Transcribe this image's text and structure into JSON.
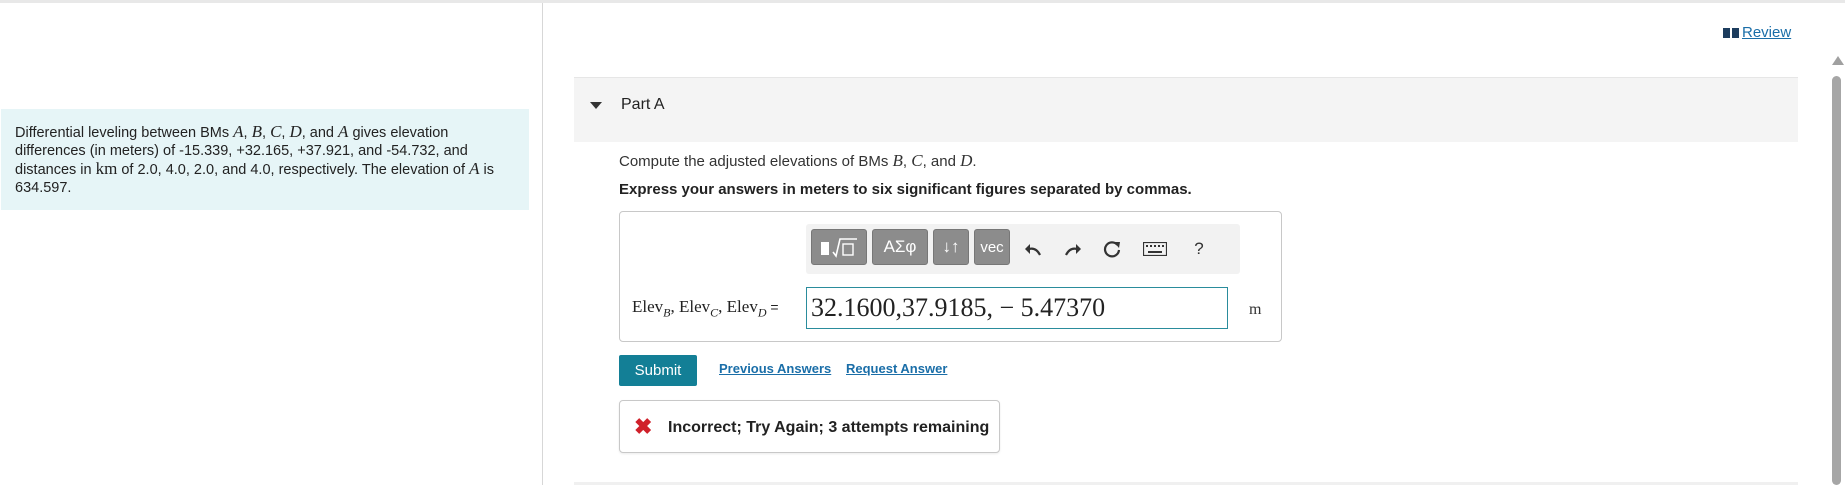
{
  "problem": {
    "t1": "Differential leveling between BMs ",
    "bmA": "A",
    "c1": ", ",
    "bmB": "B",
    "c2": ", ",
    "bmC": "C",
    "c3": ", ",
    "bmD": "D",
    "t2": ", and ",
    "bmA2": "A",
    "t3": " gives elevation differences (in meters) of -15.339, +32.165, +37.921, and -54.732, and distances in ",
    "km": "km",
    "t4": " of 2.0, 4.0, 2.0, and 4.0, respectively. The elevation of ",
    "bmA3": "A",
    "t5": " is 634.597."
  },
  "review": {
    "label": "Review",
    "icon": "book-icon"
  },
  "part": {
    "title": "Part A"
  },
  "question": {
    "t1": "Compute the adjusted elevations of BMs ",
    "b": "B",
    "c": ", ",
    "cc": "C",
    "and": ", and ",
    "d": "D",
    "end": "."
  },
  "instruction": "Express your answers in meters to six significant figures separated by commas.",
  "toolbar": {
    "greek": "ΑΣφ",
    "arrows": "↓↑",
    "vec": "vec",
    "help": "?"
  },
  "answer": {
    "elev": "Elev",
    "sub_b": "B",
    "sub_c": "C",
    "sub_d": "D",
    "sep": ", ",
    "eq": " =",
    "value": "32.1600,37.9185, − 5.47370",
    "unit": "m"
  },
  "buttons": {
    "submit": "Submit",
    "previous": "Previous Answers",
    "request": "Request Answer"
  },
  "feedback": {
    "icon": "✖",
    "text": "Incorrect; Try Again; 3 attempts remaining"
  },
  "colors": {
    "accent": "#137f96",
    "link": "#1a6ea8",
    "problem_bg": "#e6f5f7",
    "error": "#d0202a"
  }
}
